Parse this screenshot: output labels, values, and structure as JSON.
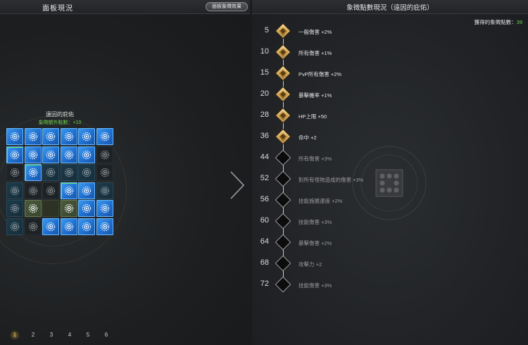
{
  "left": {
    "title": "面板現況",
    "effect_button": "面板象徵效果",
    "board_title": "遠因的庇佑",
    "board_subtitle": "象徵額外點數：+10",
    "tiles": [
      [
        "blue",
        "blue",
        "blue",
        "blue",
        "blue",
        "blue"
      ],
      [
        "blue-g",
        "blue",
        "blue",
        "blue",
        "blue",
        "dark"
      ],
      [
        "dark",
        "blue-g",
        "dim",
        "dim",
        "dim",
        "dark"
      ],
      [
        "dim",
        "dark",
        "dark",
        "blue-g",
        "blue",
        "dim"
      ],
      [
        "dim",
        "olive",
        "olive-dark",
        "olive",
        "blue",
        "blue"
      ],
      [
        "dim",
        "dark",
        "blue",
        "blue",
        "blue",
        "blue"
      ]
    ],
    "pages": [
      "1",
      "2",
      "3",
      "4",
      "5",
      "6"
    ],
    "active_page": "1"
  },
  "right": {
    "title": "象徵點數現況（遠因的庇佑）",
    "points_label": "獲得的象徵點數：",
    "points_value": "39",
    "milestones": [
      {
        "level": "5",
        "desc": "一般傷害 +2%",
        "unlocked": true
      },
      {
        "level": "10",
        "desc": "所有傷害 +1%",
        "unlocked": true
      },
      {
        "level": "15",
        "desc": "PvP所有傷害 +2%",
        "unlocked": true
      },
      {
        "level": "20",
        "desc": "暴擊機率 +1%",
        "unlocked": true
      },
      {
        "level": "28",
        "desc": "HP上限 +50",
        "unlocked": true
      },
      {
        "level": "36",
        "desc": "命中 +2",
        "unlocked": true
      },
      {
        "level": "44",
        "desc": "所有傷害 +3%",
        "unlocked": false
      },
      {
        "level": "52",
        "desc": "對所有怪物造成的傷害 +3%",
        "unlocked": false
      },
      {
        "level": "56",
        "desc": "技能施展速度 +2%",
        "unlocked": false
      },
      {
        "level": "60",
        "desc": "技能傷害 +3%",
        "unlocked": false
      },
      {
        "level": "64",
        "desc": "暴擊傷害 +2%",
        "unlocked": false
      },
      {
        "level": "68",
        "desc": "攻擊力 +2",
        "unlocked": false
      },
      {
        "level": "72",
        "desc": "技能傷害 +3%",
        "unlocked": false
      }
    ]
  },
  "colors": {
    "accent_green": "#6ed04e",
    "gold": "#c9963c",
    "tile_blue": "#2a82e0"
  }
}
